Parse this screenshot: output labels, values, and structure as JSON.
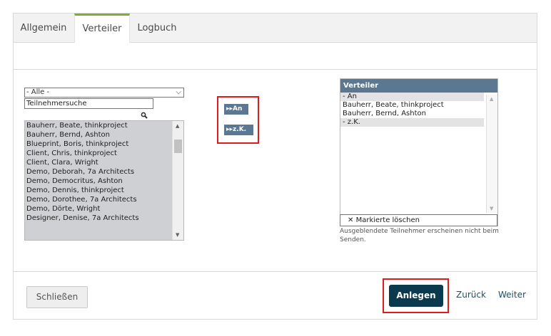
{
  "tabs": [
    {
      "label": "Allgemein"
    },
    {
      "label": "Verteiler"
    },
    {
      "label": "Logbuch"
    }
  ],
  "filter": {
    "selected": "- Alle -",
    "search_value": "Teilnehmersuche"
  },
  "participants": [
    "Bauherr, Beate, thinkproject",
    "Bauherr, Bernd, Ashton",
    "Blueprint, Boris, thinkproject",
    "Client, Chris, thinkproject",
    "Client, Clara, Wright",
    "Demo, Deborah, 7a Architects",
    "Demo, Democritus, Ashton",
    "Demo, Dennis, thinkproject",
    "Demo, Dorothee, 7a Architects",
    "Demo, Dörte, Wright",
    "Designer, Denise, 7a Architects"
  ],
  "actions": {
    "an_label": "An",
    "zk_label": "z.K."
  },
  "verteiler": {
    "title": "Verteiler",
    "items": [
      {
        "label": "- An",
        "group": true
      },
      {
        "label": "Bauherr, Beate, thinkproject",
        "group": false
      },
      {
        "label": "Bauherr, Bernd, Ashton",
        "group": false
      },
      {
        "label": "- z.K.",
        "group": true
      }
    ],
    "delete_label": "Markierte löschen",
    "hint": "Ausgeblendete Teilnehmer erscheinen nicht beim Senden."
  },
  "footer": {
    "close_label": "Schließen",
    "create_label": "Anlegen",
    "back_label": "Zurück",
    "next_label": "Weiter"
  },
  "colors": {
    "accent_tab": "#7ab02c",
    "header_blue": "#5a7892",
    "primary_button": "#0b3a4f",
    "highlight": "#e01b1b"
  }
}
